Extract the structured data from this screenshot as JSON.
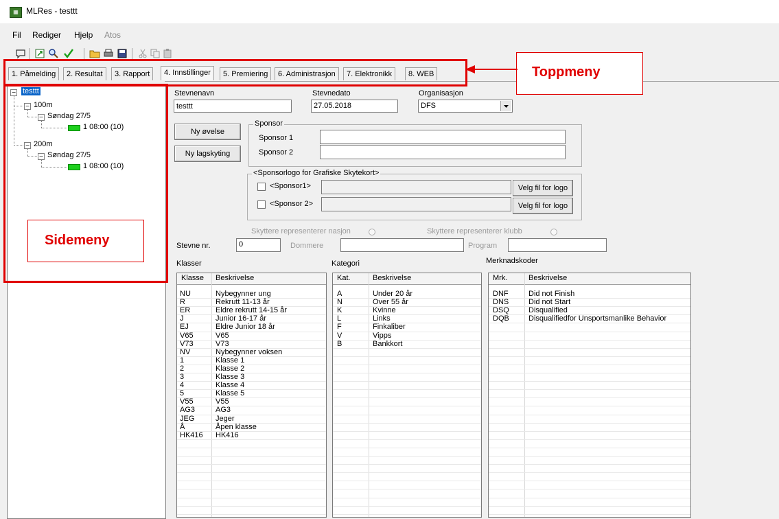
{
  "window": {
    "title": "MLRes - testtt",
    "app_icon": "mlres-app-icon"
  },
  "menubar": {
    "items": [
      "Fil",
      "Rediger",
      "Hjelp",
      "Atos"
    ]
  },
  "toolbar": {
    "icons": [
      "chat-icon",
      "refresh-icon",
      "search-icon",
      "check-icon",
      "open-folder-icon",
      "print-icon",
      "save-icon",
      "cut-icon",
      "copy-icon",
      "paste-icon"
    ]
  },
  "tabs": [
    {
      "label": "1. Påmelding",
      "active": false
    },
    {
      "label": "2. Resultat",
      "active": false
    },
    {
      "label": "3. Rapport",
      "active": false
    },
    {
      "label": "4. Innstillinger",
      "active": true
    },
    {
      "label": "5. Premiering",
      "active": false
    },
    {
      "label": "6. Administrasjon",
      "active": false
    },
    {
      "label": "7. Elektronikk",
      "active": false
    },
    {
      "label": "8. WEB",
      "active": false
    }
  ],
  "tree": {
    "root": "testtt",
    "nodes": [
      {
        "name": "100m",
        "day": "Søndag 27/5",
        "session": "1 08:00  (10)"
      },
      {
        "name": "200m",
        "day": "Søndag 27/5",
        "session": "1 08:00  (10)"
      }
    ]
  },
  "annotations": {
    "toppmeny": "Toppmeny",
    "sidemeny": "Sidemeny",
    "accent": "#e00000"
  },
  "form": {
    "stevnenavn_label": "Stevnenavn",
    "stevnenavn_value": "testtt",
    "stevnedato_label": "Stevnedato",
    "stevnedato_value": "27.05.2018",
    "organisasjon_label": "Organisasjon",
    "organisasjon_value": "DFS",
    "ny_ovelse_button": "Ny øvelse",
    "ny_lagskyting_button": "Ny lagskyting",
    "sponsor_group": "Sponsor",
    "sponsor1_label": "Sponsor 1",
    "sponsor2_label": "Sponsor 2",
    "logo_group": "<Sponsorlogo for Grafiske Skytekort>",
    "logo_sponsor1": "<Sponsor1>",
    "logo_sponsor2": "<Sponsor 2>",
    "velg_fil_button": "Velg fil for logo",
    "nasjon_radio": "Skyttere representerer nasjon",
    "klubb_radio": "Skyttere representerer klubb",
    "stevne_nr_label": "Stevne nr.",
    "stevne_nr_value": "0",
    "dommere_label": "Dommere",
    "program_label": "Program"
  },
  "klasser": {
    "title": "Klasser",
    "headers": [
      "Klasse",
      "Beskrivelse"
    ],
    "rows": [
      [
        "NU",
        "Nybegynner ung"
      ],
      [
        "R",
        "Rekrutt 11-13 år"
      ],
      [
        "ER",
        "Eldre rekrutt 14-15 år"
      ],
      [
        "J",
        "Junior 16-17 år"
      ],
      [
        "EJ",
        "Eldre Junior 18 år"
      ],
      [
        "V65",
        "V65"
      ],
      [
        "V73",
        "V73"
      ],
      [
        "NV",
        "Nybegynner voksen"
      ],
      [
        "1",
        "Klasse 1"
      ],
      [
        "2",
        "Klasse 2"
      ],
      [
        "3",
        "Klasse 3"
      ],
      [
        "4",
        "Klasse 4"
      ],
      [
        "5",
        "Klasse 5"
      ],
      [
        "V55",
        "V55"
      ],
      [
        "AG3",
        "AG3"
      ],
      [
        "JEG",
        "Jeger"
      ],
      [
        "Å",
        "Åpen klasse"
      ],
      [
        "HK416",
        "HK416"
      ]
    ]
  },
  "kategori": {
    "title": "Kategori",
    "headers": [
      "Kat.",
      "Beskrivelse"
    ],
    "rows": [
      [
        "A",
        "Under 20 år"
      ],
      [
        "N",
        "Over 55 år"
      ],
      [
        "K",
        "Kvinne"
      ],
      [
        "L",
        "Links"
      ],
      [
        "F",
        "Finkaliber"
      ],
      [
        "V",
        "Vipps"
      ],
      [
        "B",
        "Bankkort"
      ]
    ]
  },
  "merknadskoder": {
    "title": "Merknadskoder",
    "headers": [
      "Mrk.",
      "Beskrivelse"
    ],
    "rows": [
      [
        "DNF",
        "Did not Finish"
      ],
      [
        "DNS",
        "Did not Start"
      ],
      [
        "DSQ",
        "Disqualified"
      ],
      [
        "DQB",
        "Disqualifiedfor Unsportsmanlike Behavior"
      ]
    ]
  }
}
